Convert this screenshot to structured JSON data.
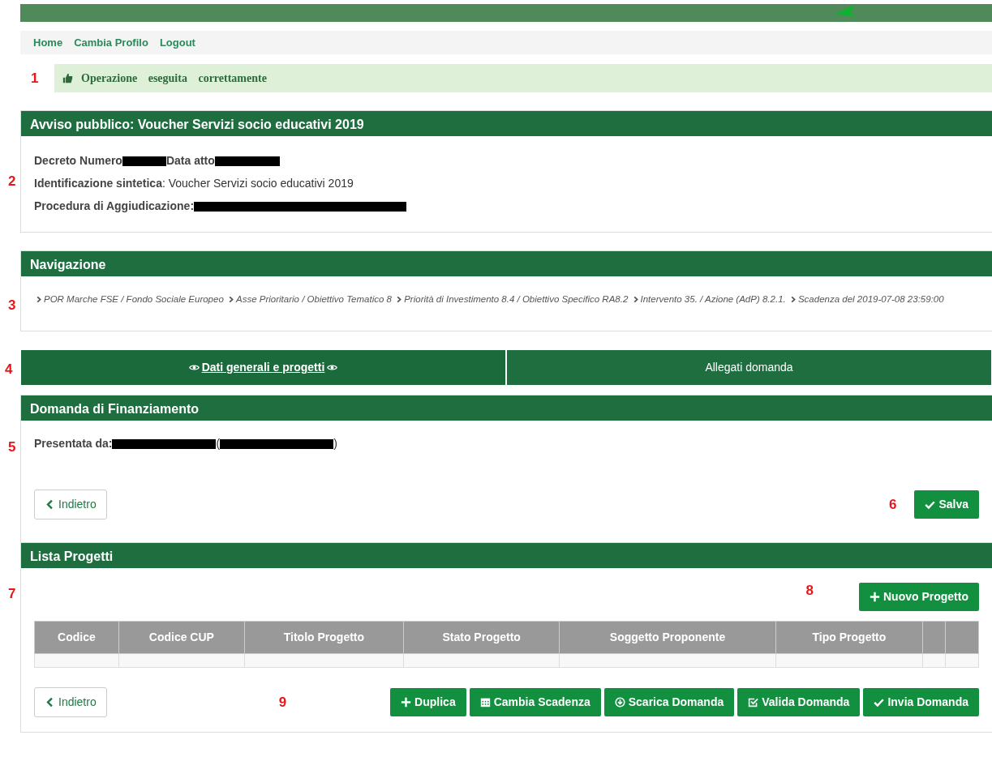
{
  "nav_links": [
    "Home",
    "Cambia Profilo",
    "Logout"
  ],
  "alert": {
    "marker": "1",
    "text": "Operazione eseguita correttamente"
  },
  "avviso": {
    "title": "Avviso pubblico: Voucher Servizi socio educativi 2019",
    "marker": "2",
    "rows": [
      [
        {
          "kind": "label",
          "text": "Decreto Numero"
        },
        {
          "kind": "redacted"
        },
        {
          "kind": "label",
          "text": "Data atto"
        },
        {
          "kind": "redacted"
        }
      ],
      [
        {
          "kind": "label",
          "text": "Identificazione sintetica"
        },
        {
          "kind": "value",
          "text": ": Voucher Servizi socio educativi 2019"
        }
      ],
      [
        {
          "kind": "label",
          "text": "Procedura di Aggiudicazione:"
        },
        {
          "kind": "redacted"
        }
      ]
    ]
  },
  "navigazione": {
    "title": "Navigazione",
    "marker": "3",
    "crumbs": [
      "POR Marche FSE / Fondo Sociale Europeo",
      "Asse Prioritario / Obiettivo Tematico 8",
      "Priorità di Investimento 8.4 / Obiettivo Specifico RA8.2",
      "Intervento 35. / Azione (AdP) 8.2.1.",
      "Scadenza del 2019-07-08 23:59:00"
    ]
  },
  "tabs": {
    "marker": "4",
    "items": [
      {
        "label": "Dati generali e progetti",
        "selected": true
      },
      {
        "label": "Allegati domanda",
        "selected": false
      }
    ]
  },
  "domanda": {
    "title": "Domanda di Finanziamento",
    "marker": "5",
    "segments": [
      {
        "kind": "label",
        "text": "Presentata da:"
      },
      {
        "kind": "redacted"
      },
      {
        "kind": "value",
        "text": "("
      },
      {
        "kind": "redacted"
      },
      {
        "kind": "value",
        "text": ")"
      }
    ],
    "back_button": "Indietro",
    "save_marker": "6",
    "save_button": "Salva"
  },
  "lista": {
    "title": "Lista Progetti",
    "marker": "7",
    "new_marker": "8",
    "new_button": "Nuovo Progetto",
    "columns": [
      "Codice",
      "Codice CUP",
      "Titolo Progetto",
      "Stato Progetto",
      "Soggetto Proponente",
      "Tipo Progetto"
    ],
    "back_button": "Indietro",
    "actions_marker": "9",
    "actions": [
      {
        "label": "Duplica"
      },
      {
        "label": "Cambia Scadenza"
      },
      {
        "label": "Scarica Domanda"
      },
      {
        "label": "Valida Domanda"
      },
      {
        "label": "Invia Domanda"
      }
    ]
  }
}
